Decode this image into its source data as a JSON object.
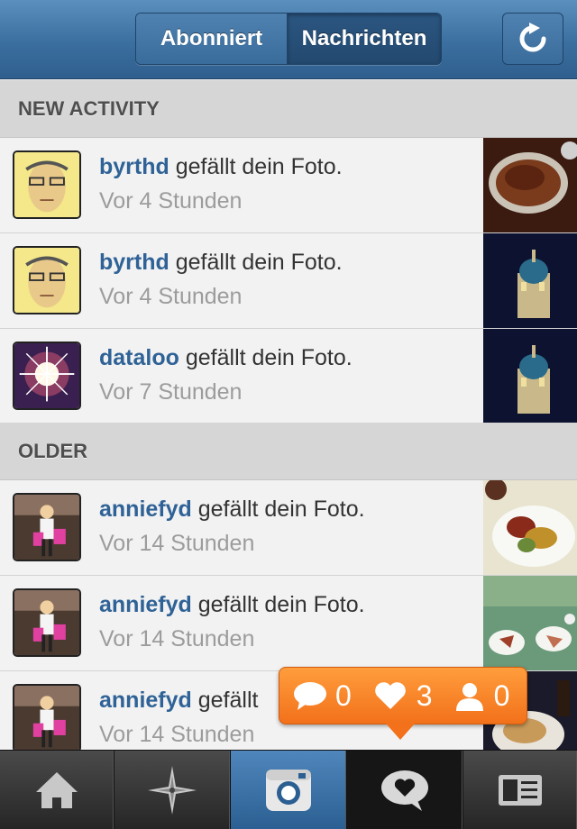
{
  "header": {
    "segment_following": "Abonniert",
    "segment_news": "Nachrichten",
    "refresh_icon": "refresh-icon"
  },
  "sections": {
    "new_activity": "NEW ACTIVITY",
    "older": "OLDER"
  },
  "new_items": [
    {
      "user": "byrthd",
      "action": " gefällt dein Foto.",
      "time": "Vor 4 Stunden"
    },
    {
      "user": "byrthd",
      "action": " gefällt dein Foto.",
      "time": "Vor 4 Stunden"
    },
    {
      "user": "dataloo",
      "action": " gefällt dein Foto.",
      "time": "Vor 7 Stunden"
    }
  ],
  "older_items": [
    {
      "user": "anniefyd",
      "action": " gefällt dein Foto.",
      "time": "Vor 14 Stunden"
    },
    {
      "user": "anniefyd",
      "action": " gefällt dein Foto.",
      "time": "Vor 14 Stunden"
    },
    {
      "user": "anniefyd",
      "action": " gefällt",
      "time": "Vor 14 Stunden"
    }
  ],
  "notification": {
    "comments": "0",
    "likes": "3",
    "followers": "0"
  },
  "tabs": [
    "home-icon",
    "explore-icon",
    "camera-icon",
    "news-icon",
    "profile-icon"
  ],
  "colors": {
    "header": "#3b6f9f",
    "username": "#2f6296",
    "bubble": "#f2711a"
  }
}
